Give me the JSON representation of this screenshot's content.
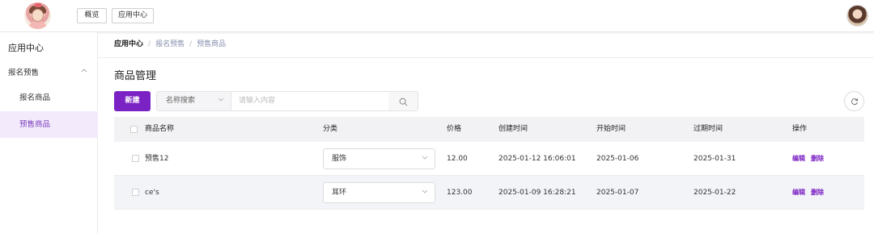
{
  "header": {
    "nav": [
      {
        "label": "概览"
      },
      {
        "label": "应用中心"
      }
    ]
  },
  "sidebar": {
    "title": "应用中心",
    "group": {
      "label": "报名预售",
      "icon": "chevron-up-icon"
    },
    "items": [
      {
        "label": "报名商品",
        "active": false
      },
      {
        "label": "预售商品",
        "active": true
      }
    ]
  },
  "breadcrumb": [
    "应用中心",
    "报名预售",
    "预售商品"
  ],
  "page": {
    "title": "商品管理"
  },
  "toolbar": {
    "new_label": "新建",
    "search_field": "名称搜索",
    "search_placeholder": "请输入内容"
  },
  "colors": {
    "accent": "#7b22c4",
    "active_bg": "#f3eafb"
  },
  "table": {
    "headers": {
      "name": "商品名称",
      "category": "分类",
      "price": "价格",
      "created": "创建时间",
      "start": "开始时间",
      "expire": "过期时间",
      "ops": "操作"
    },
    "rows": [
      {
        "name": "预售12",
        "category": "服饰",
        "price": "12.00",
        "created": "2025-01-12 16:06:01",
        "start": "2025-01-06",
        "expire": "2025-01-31",
        "edit": "编辑",
        "delete": "删除"
      },
      {
        "name": "ce's",
        "category": "耳环",
        "price": "123.00",
        "created": "2025-01-09 16:28:21",
        "start": "2025-01-07",
        "expire": "2025-01-22",
        "edit": "编辑",
        "delete": "删除"
      }
    ]
  }
}
